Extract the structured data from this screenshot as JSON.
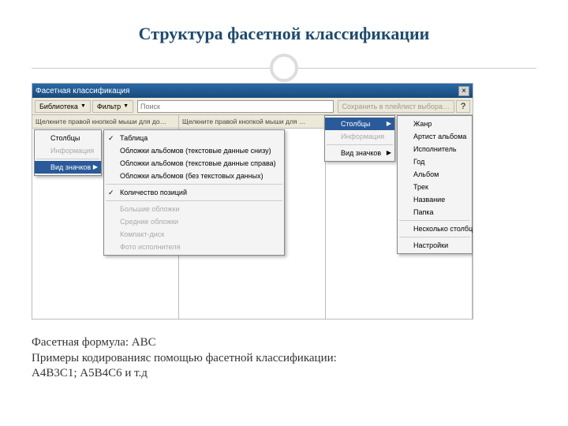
{
  "title": "Структура фасетной классификации",
  "window": {
    "title": "Фасетная классификация",
    "close": "×"
  },
  "toolbar": {
    "library": "Библиотека",
    "filter": "Фильтр",
    "search_placeholder": "Поиск",
    "save_playlist": "Сохранить в плейлист выбора…",
    "help": "?"
  },
  "columns": {
    "header1": "Щелкните правой кнопкой мыши для до…",
    "header2": "Щелкните правой кнопкой мыши для …"
  },
  "sidebar1": {
    "items": [
      {
        "label": "Столбцы",
        "disabled": false
      },
      {
        "label": "Информация",
        "disabled": true
      },
      {
        "label": "Вид значков",
        "disabled": false,
        "selected": true
      }
    ]
  },
  "menu1": {
    "items": [
      {
        "label": "Таблица",
        "checked": true
      },
      {
        "label": "Обложки альбомов (текстовые данные снизу)"
      },
      {
        "label": "Обложки альбомов (текстовые данные справа)"
      },
      {
        "label": "Обложки альбомов (без текстовых данных)"
      }
    ],
    "sep1": true,
    "items2": [
      {
        "label": "Количество позиций",
        "checked": true
      }
    ],
    "sep2": true,
    "items3": [
      {
        "label": "Большие обложки",
        "disabled": true
      },
      {
        "label": "Средние обложки",
        "disabled": true
      },
      {
        "label": "Компакт-диск",
        "disabled": true
      },
      {
        "label": "Фото исполнителя",
        "disabled": true
      }
    ]
  },
  "sidebar2": {
    "items": [
      {
        "label": "Столбцы",
        "selected": true,
        "arrow": true
      },
      {
        "label": "Информация",
        "disabled": true
      },
      {
        "label": "Вид значков",
        "arrow": true
      }
    ]
  },
  "menu2": {
    "items": [
      {
        "label": "Жанр"
      },
      {
        "label": "Артист альбома"
      },
      {
        "label": "Исполнитель"
      },
      {
        "label": "Год"
      },
      {
        "label": "Альбом"
      },
      {
        "label": "Трек"
      },
      {
        "label": "Название"
      },
      {
        "label": "Папка"
      }
    ],
    "sep1": true,
    "items2": [
      {
        "label": "Несколько столбцов"
      }
    ],
    "sep2": true,
    "items3": [
      {
        "label": "Настройки"
      }
    ]
  },
  "footer": {
    "line1": "Фасетная формула: АВС",
    "line2": "Примеры кодированияс помощью фасетной классификации:",
    "line3": "А4В3С1; А5В4С6 и т.д"
  }
}
